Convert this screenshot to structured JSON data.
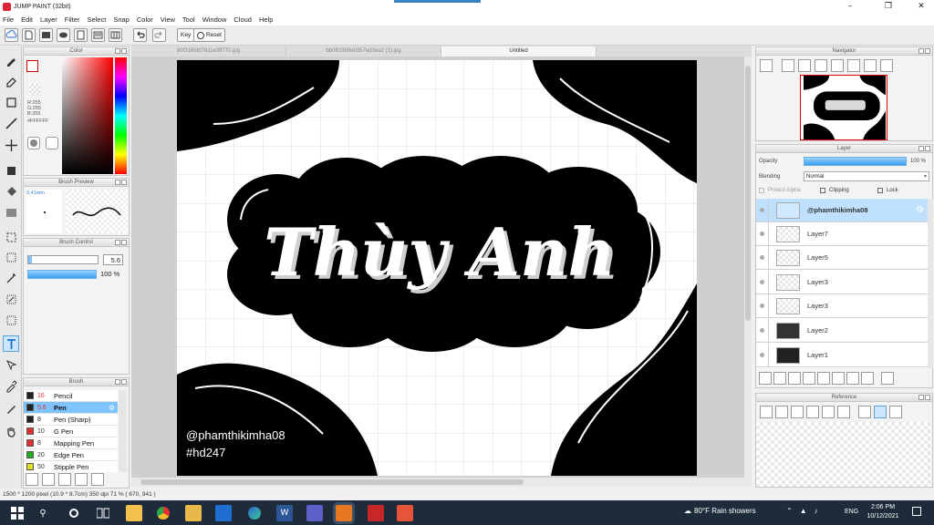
{
  "window": {
    "title": "JUMP PAINT (32bit)",
    "minimize_icon": "minimize-icon",
    "maximize_icon": "restore-icon",
    "close_icon": "close-icon"
  },
  "menu": [
    "File",
    "Edit",
    "Layer",
    "Filter",
    "Select",
    "Snap",
    "Color",
    "View",
    "Tool",
    "Window",
    "Cloud",
    "Help"
  ],
  "toolbar": {
    "key_label": "Key",
    "reset_label": "Reset"
  },
  "panels": {
    "color": {
      "title": "Color",
      "r": "R:255",
      "g": "G:255",
      "b": "B:255",
      "hex": "#FFFFFF"
    },
    "brush_preview": {
      "title": "Brush Preview",
      "size": "0.41mm"
    },
    "brush_control": {
      "title": "Brush Control",
      "size_value": "5.6",
      "opacity_value": "100 %"
    },
    "brush": {
      "title": "Brush",
      "items": [
        {
          "size": "16",
          "name": "Pencil",
          "color": "#222222"
        },
        {
          "size": "5.6",
          "name": "Pen",
          "color": "#222222"
        },
        {
          "size": "8",
          "name": "Pen (Sharp)",
          "color": "#222222"
        },
        {
          "size": "10",
          "name": "G Pen",
          "color": "#e03030"
        },
        {
          "size": "8",
          "name": "Mapping Pen",
          "color": "#e03030"
        },
        {
          "size": "20",
          "name": "Edge Pen",
          "color": "#22aa22"
        },
        {
          "size": "50",
          "name": "Stipple Pen",
          "color": "#dddd22"
        }
      ]
    },
    "navigator": {
      "title": "Navigator"
    },
    "layer": {
      "title": "Layer",
      "opacity_label": "Opacity",
      "opacity_value": "100 %",
      "blending_label": "Blending",
      "blending_value": "Normal",
      "protect_alpha": "Protect Alpha",
      "clipping": "Clipping",
      "lock": "Lock",
      "layers": [
        "@phamthikimha08",
        "Layer7",
        "Layer5",
        "Layer3",
        "Layer3",
        "Layer2",
        "Layer1"
      ]
    },
    "reference": {
      "title": "Reference"
    }
  },
  "tabs": [
    "80f3165fd7611e3ff770.jpg",
    "bb0f02f69eb357ed0ea2 (1).jpg",
    "Untitled"
  ],
  "artwork": {
    "main_text": "Thùy Anh",
    "handle": "@phamthikimha08",
    "hashtag": "#hd247"
  },
  "status_text": "1500 * 1200 pixel  (10.9 * 8.7cm)  350 dpi  71 %  ( 670, 941 )",
  "taskbar": {
    "weather": "80°F  Rain showers",
    "lang": "ENG",
    "time": "2:06 PM",
    "date": "10/12/2021"
  },
  "colors": {
    "accent": "#3399ff",
    "active_layer": "#bfe1ff",
    "fg": "#ffffff"
  }
}
